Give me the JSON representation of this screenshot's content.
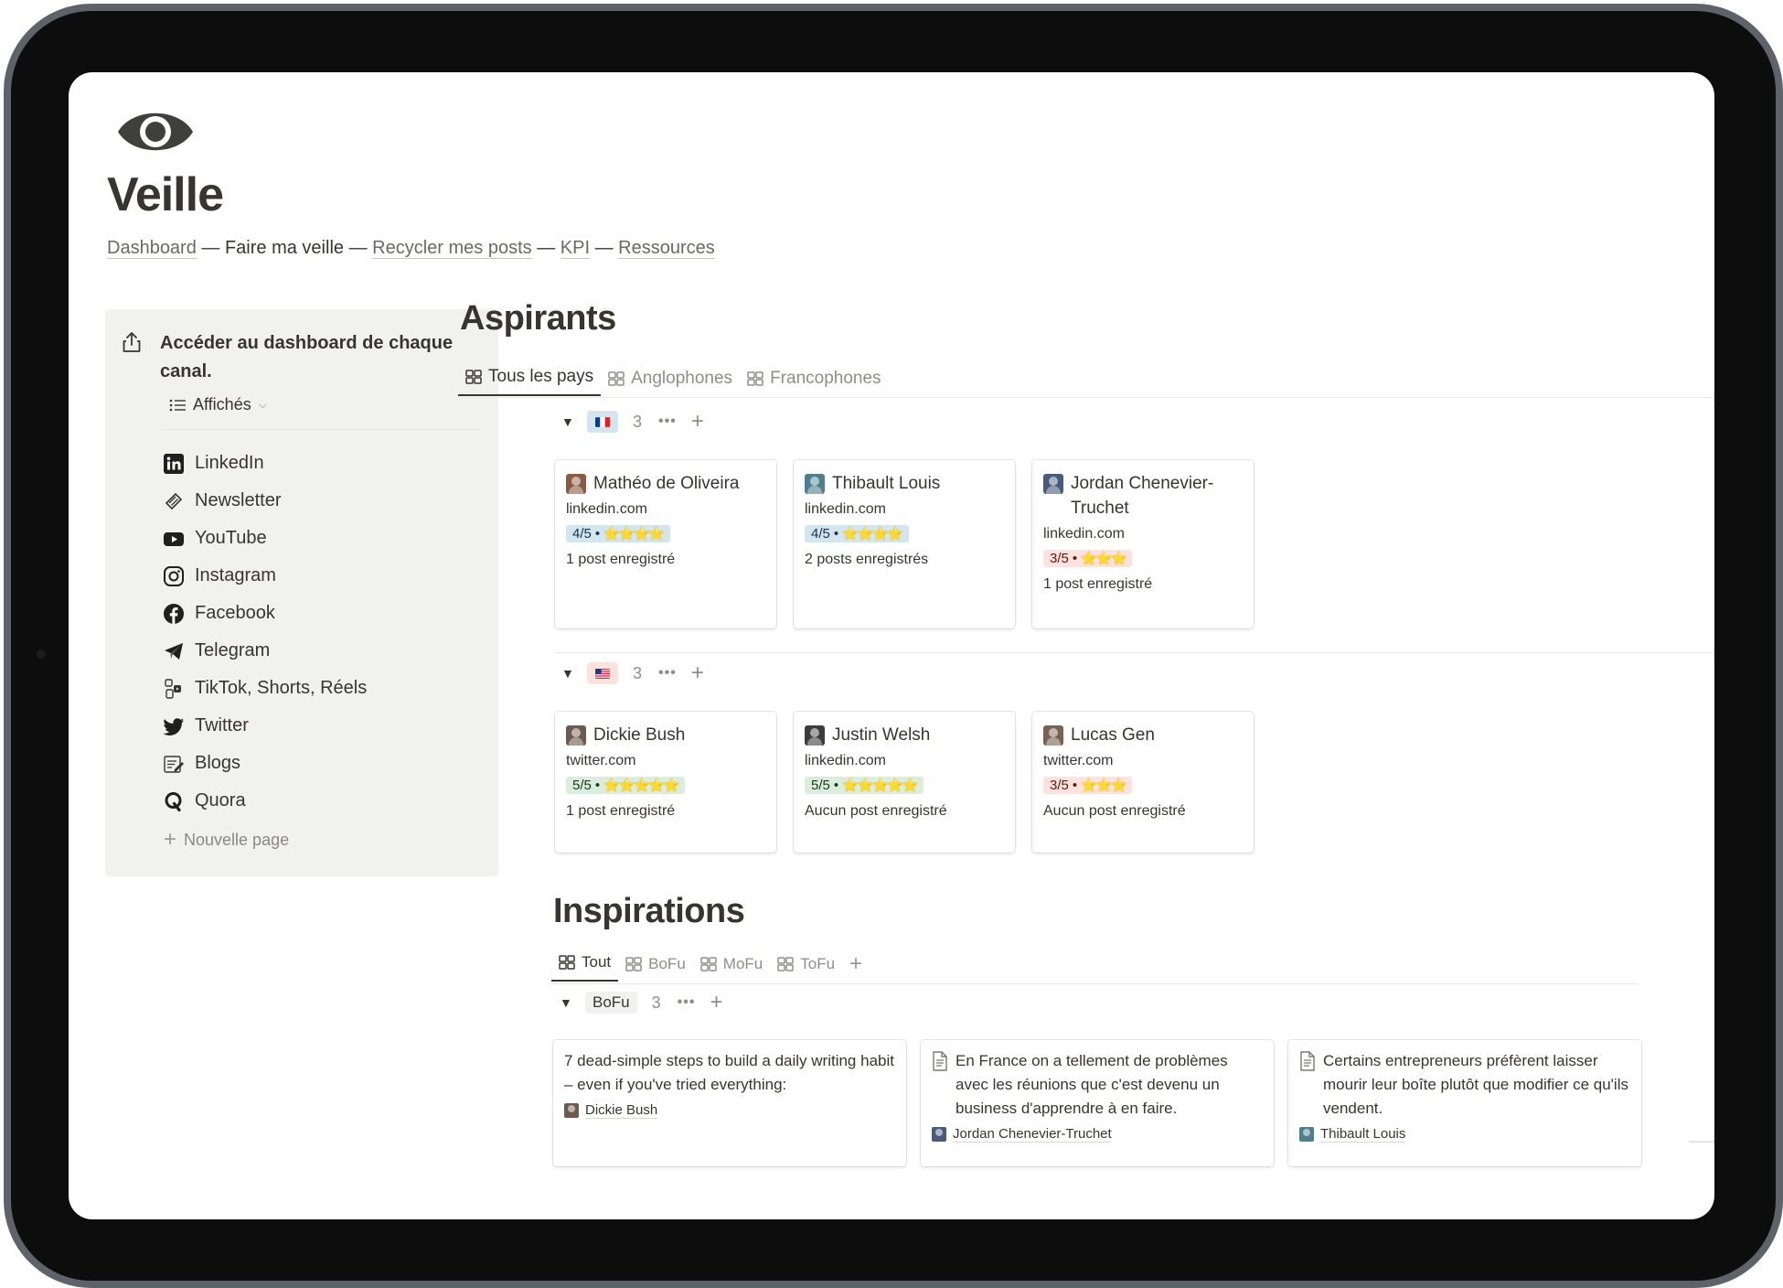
{
  "page": {
    "title": "Veille",
    "icon": "eye-icon"
  },
  "breadcrumb": {
    "dashboard": "Dashboard",
    "sep": "—",
    "current": "Faire ma veille",
    "recycle": "Recycler mes posts",
    "kpi": "KPI",
    "resources": "Ressources"
  },
  "callout": {
    "icon": "share-icon",
    "text": "Accéder au dashboard de chaque canal.",
    "view_label": "Affichés",
    "channels": [
      {
        "label": "LinkedIn",
        "icon": "linkedin-icon"
      },
      {
        "label": "Newsletter",
        "icon": "newsletter-icon"
      },
      {
        "label": "YouTube",
        "icon": "youtube-icon"
      },
      {
        "label": "Instagram",
        "icon": "instagram-icon"
      },
      {
        "label": "Facebook",
        "icon": "facebook-icon"
      },
      {
        "label": "Telegram",
        "icon": "telegram-icon"
      },
      {
        "label": "TikTok, Shorts, Réels",
        "icon": "tiktok-icon"
      },
      {
        "label": "Twitter",
        "icon": "twitter-icon"
      },
      {
        "label": "Blogs",
        "icon": "blogs-icon"
      },
      {
        "label": "Quora",
        "icon": "quora-icon"
      }
    ],
    "new_page": "Nouvelle page"
  },
  "aspirants": {
    "heading": "Aspirants",
    "tabs": [
      "Tous les pays",
      "Anglophones",
      "Francophones"
    ],
    "groups": [
      {
        "flag": "france-flag-icon",
        "count": "3",
        "cards": [
          {
            "name": "Mathéo de Oliveira",
            "site": "linkedin.com",
            "rating": "4/5",
            "stars": "⭐⭐⭐⭐",
            "color": "blue",
            "posts": "1 post enregistré",
            "avatar_color": "#8a5a44"
          },
          {
            "name": "Thibault Louis",
            "site": "linkedin.com",
            "rating": "4/5",
            "stars": "⭐⭐⭐⭐",
            "color": "blue",
            "posts": "2 posts enregistrés",
            "avatar_color": "#4f7f8f"
          },
          {
            "name": "Jordan Chenevier-Truchet",
            "site": "linkedin.com",
            "rating": "3/5",
            "stars": "⭐⭐⭐",
            "color": "red",
            "posts": "1 post enregistré",
            "avatar_color": "#4a5a7a"
          }
        ]
      },
      {
        "flag": "usa-flag-icon",
        "count": "3",
        "cards": [
          {
            "name": "Dickie Bush",
            "site": "twitter.com",
            "rating": "5/5",
            "stars": "⭐⭐⭐⭐⭐",
            "color": "green",
            "posts": "1 post enregistré",
            "avatar_color": "#6b5a4e"
          },
          {
            "name": "Justin Welsh",
            "site": "linkedin.com",
            "rating": "5/5",
            "stars": "⭐⭐⭐⭐⭐",
            "color": "green",
            "posts": "Aucun post enregistré",
            "avatar_color": "#3c3c3c"
          },
          {
            "name": "Lucas Gen",
            "site": "twitter.com",
            "rating": "3/5",
            "stars": "⭐⭐⭐",
            "color": "red",
            "posts": "Aucun post enregistré",
            "avatar_color": "#7a6250"
          }
        ]
      }
    ]
  },
  "inspirations": {
    "heading": "Inspirations",
    "tabs": [
      "Tout",
      "BoFu",
      "MoFu",
      "ToFu"
    ],
    "group": {
      "label": "BoFu",
      "count": "3"
    },
    "cards": [
      {
        "title": "7 dead-simple steps to build a daily writing habit – even if you've tried everything:",
        "author": "Dickie Bush",
        "has_doc_icon": false,
        "avatar_color": "#6b5a4e"
      },
      {
        "title": "En France on a tellement de problèmes avec les réunions que c'est devenu un business d'apprendre à en faire.",
        "author": "Jordan Chenevier-Truchet",
        "has_doc_icon": true,
        "avatar_color": "#4a5a7a"
      },
      {
        "title": "Certains entrepreneurs préfèrent laisser mourir leur boîte plutôt que modifier ce qu'ils vendent.",
        "author": "Thibault Louis",
        "has_doc_icon": true,
        "avatar_color": "#4f7f8f"
      }
    ]
  },
  "colors": {
    "text": "#37352f",
    "muted": "#8f8d88",
    "callout_bg": "#f1f1ef",
    "rating_blue": "#d3e5ef",
    "rating_red": "#ffe2dd",
    "rating_green": "#dbeddb"
  }
}
